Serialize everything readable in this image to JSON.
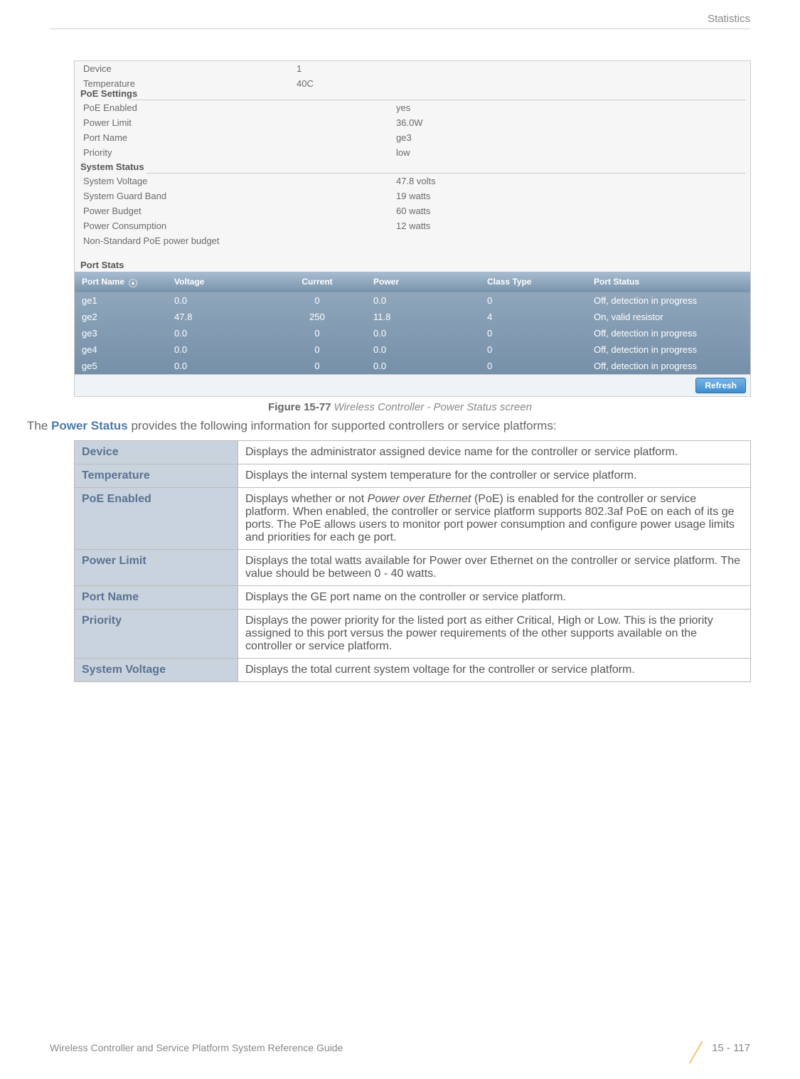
{
  "header": {
    "section": "Statistics"
  },
  "screenshot": {
    "top": {
      "device_label": "Device",
      "device_value": "1",
      "temp_label": "Temperature",
      "temp_value": "40C"
    },
    "poe": {
      "title": "PoE Settings",
      "rows": [
        {
          "k": "PoE Enabled",
          "v": "yes"
        },
        {
          "k": "Power Limit",
          "v": "36.0W"
        },
        {
          "k": "Port Name",
          "v": "ge3"
        },
        {
          "k": "Priority",
          "v": "low"
        }
      ]
    },
    "system": {
      "title": "System Status",
      "rows": [
        {
          "k": "System Voltage",
          "v": "47.8 volts"
        },
        {
          "k": "System Guard Band",
          "v": "19 watts"
        },
        {
          "k": "Power Budget",
          "v": "60 watts"
        },
        {
          "k": "Power Consumption",
          "v": "12 watts"
        },
        {
          "k": "Non-Standard PoE power budget",
          "v": ""
        }
      ]
    },
    "port_stats": {
      "title": "Port Stats",
      "cols": [
        "Port Name",
        "Voltage",
        "Current",
        "Power",
        "Class Type",
        "Port Status"
      ],
      "rows": [
        {
          "name": "ge1",
          "volt": "0.0",
          "curr": "0",
          "pow": "0.0",
          "class": "0",
          "status": "Off, detection in progress"
        },
        {
          "name": "ge2",
          "volt": "47.8",
          "curr": "250",
          "pow": "11.8",
          "class": "4",
          "status": "On, valid resistor"
        },
        {
          "name": "ge3",
          "volt": "0.0",
          "curr": "0",
          "pow": "0.0",
          "class": "0",
          "status": "Off, detection in progress"
        },
        {
          "name": "ge4",
          "volt": "0.0",
          "curr": "0",
          "pow": "0.0",
          "class": "0",
          "status": "Off, detection in progress"
        },
        {
          "name": "ge5",
          "volt": "0.0",
          "curr": "0",
          "pow": "0.0",
          "class": "0",
          "status": "Off, detection in progress"
        }
      ]
    },
    "refresh": "Refresh"
  },
  "figure": {
    "label": "Figure 15-77",
    "caption": "Wireless Controller - Power Status screen"
  },
  "intro": {
    "pre": "The ",
    "bold": "Power Status",
    "post": " provides the following information for supported controllers or service platforms:"
  },
  "table": [
    {
      "k": "Device",
      "v": "Displays the administrator assigned device name for the controller or service platform."
    },
    {
      "k": "Temperature",
      "v": "Displays the internal system temperature for the controller or service platform."
    },
    {
      "k": "PoE Enabled",
      "v": "Displays whether or not Power over Ethernet (PoE) is enabled for the controller or service platform. When enabled, the controller or service platform supports 802.3af PoE on each of its ge ports. The PoE allows users to monitor port power consumption and configure power usage limits and priorities for each ge port.",
      "italic": "Power over Ethernet"
    },
    {
      "k": "Power Limit",
      "v": "Displays the total watts available for Power over Ethernet on the controller or service platform. The value should be between 0 - 40 watts."
    },
    {
      "k": "Port Name",
      "v": "Displays the GE port name on the controller or service platform."
    },
    {
      "k": "Priority",
      "v": "Displays the power priority for the listed port as either Critical, High or Low. This is the priority assigned to this port versus the power requirements of the other supports available on the controller or service platform."
    },
    {
      "k": "System Voltage",
      "v": "Displays the total current system voltage for the controller or service platform."
    }
  ],
  "footer": {
    "left": "Wireless Controller and Service Platform System Reference Guide",
    "right": "15 - 117"
  }
}
